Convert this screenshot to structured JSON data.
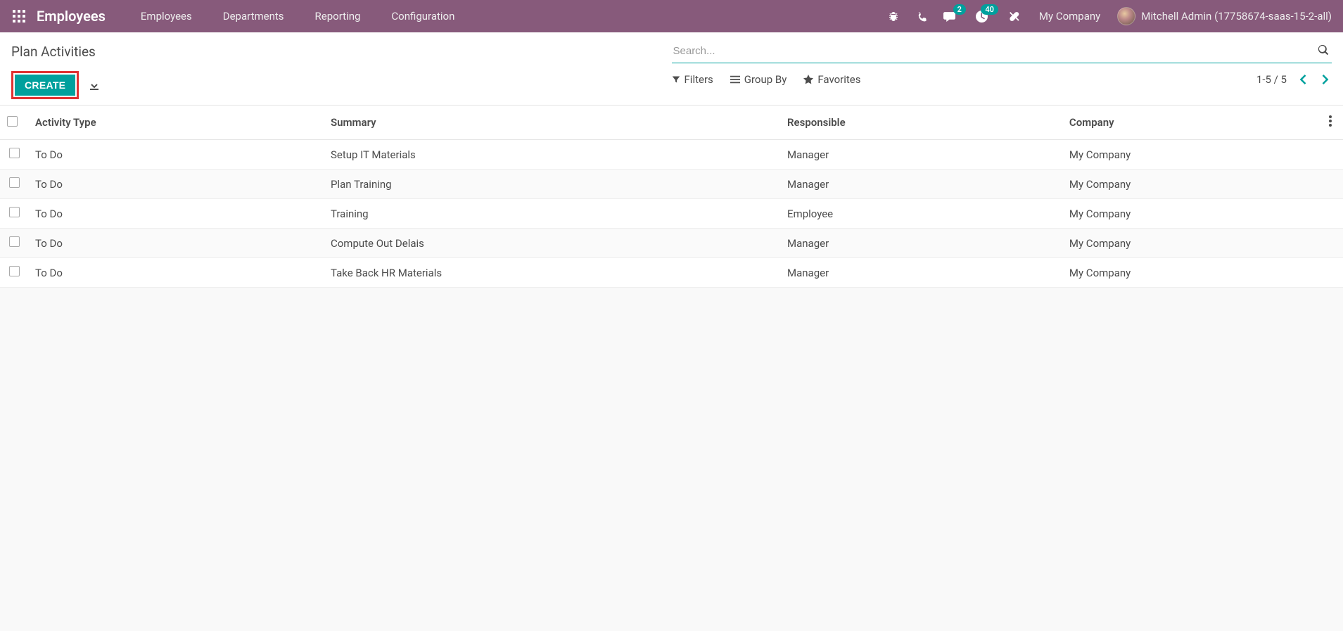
{
  "nav": {
    "app_title": "Employees",
    "menu": [
      "Employees",
      "Departments",
      "Reporting",
      "Configuration"
    ],
    "messages_badge": "2",
    "activities_badge": "40",
    "company": "My Company",
    "user": "Mitchell Admin (17758674-saas-15-2-all)"
  },
  "control_panel": {
    "title": "Plan Activities",
    "create_label": "CREATE",
    "search_placeholder": "Search...",
    "filters_label": "Filters",
    "groupby_label": "Group By",
    "favorites_label": "Favorites",
    "pager": "1-5 / 5"
  },
  "table": {
    "headers": {
      "activity_type": "Activity Type",
      "summary": "Summary",
      "responsible": "Responsible",
      "company": "Company"
    },
    "rows": [
      {
        "activity_type": "To Do",
        "summary": "Setup IT Materials",
        "responsible": "Manager",
        "company": "My Company"
      },
      {
        "activity_type": "To Do",
        "summary": "Plan Training",
        "responsible": "Manager",
        "company": "My Company"
      },
      {
        "activity_type": "To Do",
        "summary": "Training",
        "responsible": "Employee",
        "company": "My Company"
      },
      {
        "activity_type": "To Do",
        "summary": "Compute Out Delais",
        "responsible": "Manager",
        "company": "My Company"
      },
      {
        "activity_type": "To Do",
        "summary": "Take Back HR Materials",
        "responsible": "Manager",
        "company": "My Company"
      }
    ]
  }
}
